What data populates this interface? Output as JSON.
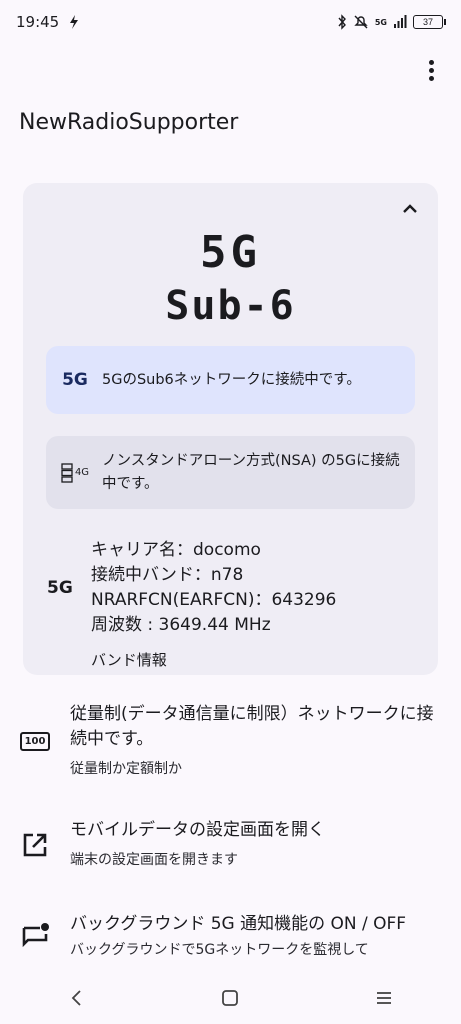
{
  "status_bar": {
    "time": "19:45",
    "network_label": "5G",
    "battery": "37"
  },
  "app": {
    "title": "NewRadioSupporter"
  },
  "card": {
    "headline": "5G",
    "subheadline": "Sub-6",
    "info_sub6": {
      "icon_label": "5G",
      "text": "5GのSub6ネットワークに接続中です。"
    },
    "info_nsa": {
      "icon_label": "4G",
      "text": "ノンスタンドアローン方式(NSA) の5Gに接続中です。"
    },
    "details": {
      "icon_label": "5G",
      "carrier": "キャリア名：docomo",
      "band": "接続中バンド：n78",
      "arfcn": "NRARFCN(EARFCN)：643296",
      "frequency": "周波数 : 3649.44 MHz"
    },
    "band_info_label": "バンド情報"
  },
  "list": {
    "metered": {
      "icon_label": "100",
      "title": "従量制(データ通信量に制限）ネットワークに接続中です。",
      "subtitle": "従量制か定額制か"
    },
    "mobile_data": {
      "title": "モバイルデータの設定画面を開く",
      "subtitle": "端末の設定画面を開きます"
    },
    "background": {
      "title": "バックグラウンド 5G 通知機能の ON / OFF",
      "subtitle": "バックグラウンドで5Gネットワークを監視して"
    }
  }
}
